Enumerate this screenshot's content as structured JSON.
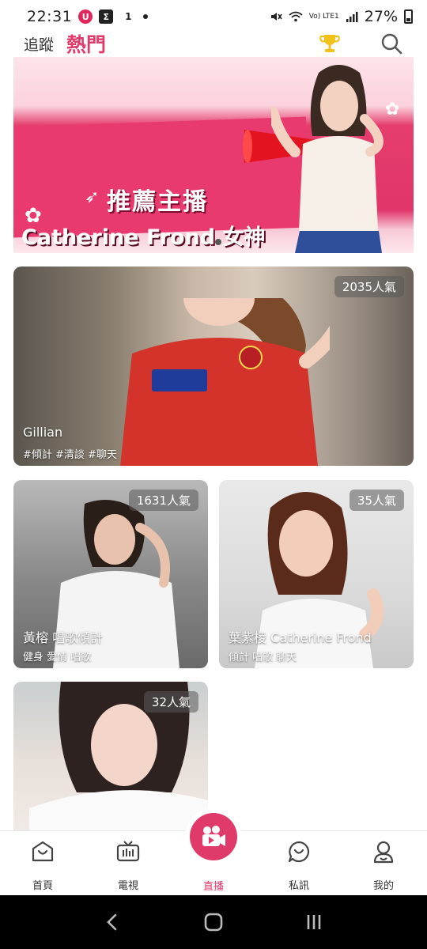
{
  "status_bar": {
    "time": "22:31",
    "battery": "27%",
    "network_label": "Vo) LTE1"
  },
  "header": {
    "tab_follow": "追蹤",
    "tab_hot": "熱門",
    "accent_color": "#e03a6b"
  },
  "banner": {
    "subtitle": "推薦主播",
    "title": "Catherine Frond 女神",
    "page_count": 2,
    "active_page": 2
  },
  "cards": [
    {
      "name": "Gillian",
      "tags": "#傾計 #清談 #聊天",
      "popularity": "2035人氣"
    },
    {
      "name": "黃榕 唱歌傾計",
      "tags": "健身 愛情 唱歌",
      "popularity": "1631人氣"
    },
    {
      "name": "葉紫棱 Catherine Frond",
      "tags": "傾計 唱歌 聊天",
      "popularity": "35人氣"
    },
    {
      "name": "",
      "tags": "",
      "popularity": "32人氣"
    }
  ],
  "bottom_nav": {
    "items": [
      {
        "label": "首頁",
        "icon": "home-icon"
      },
      {
        "label": "電視",
        "icon": "tv-icon"
      },
      {
        "label": "直播",
        "icon": "live-camera-icon",
        "active": true
      },
      {
        "label": "私訊",
        "icon": "chat-bubble-icon"
      },
      {
        "label": "我的",
        "icon": "profile-icon"
      }
    ]
  }
}
